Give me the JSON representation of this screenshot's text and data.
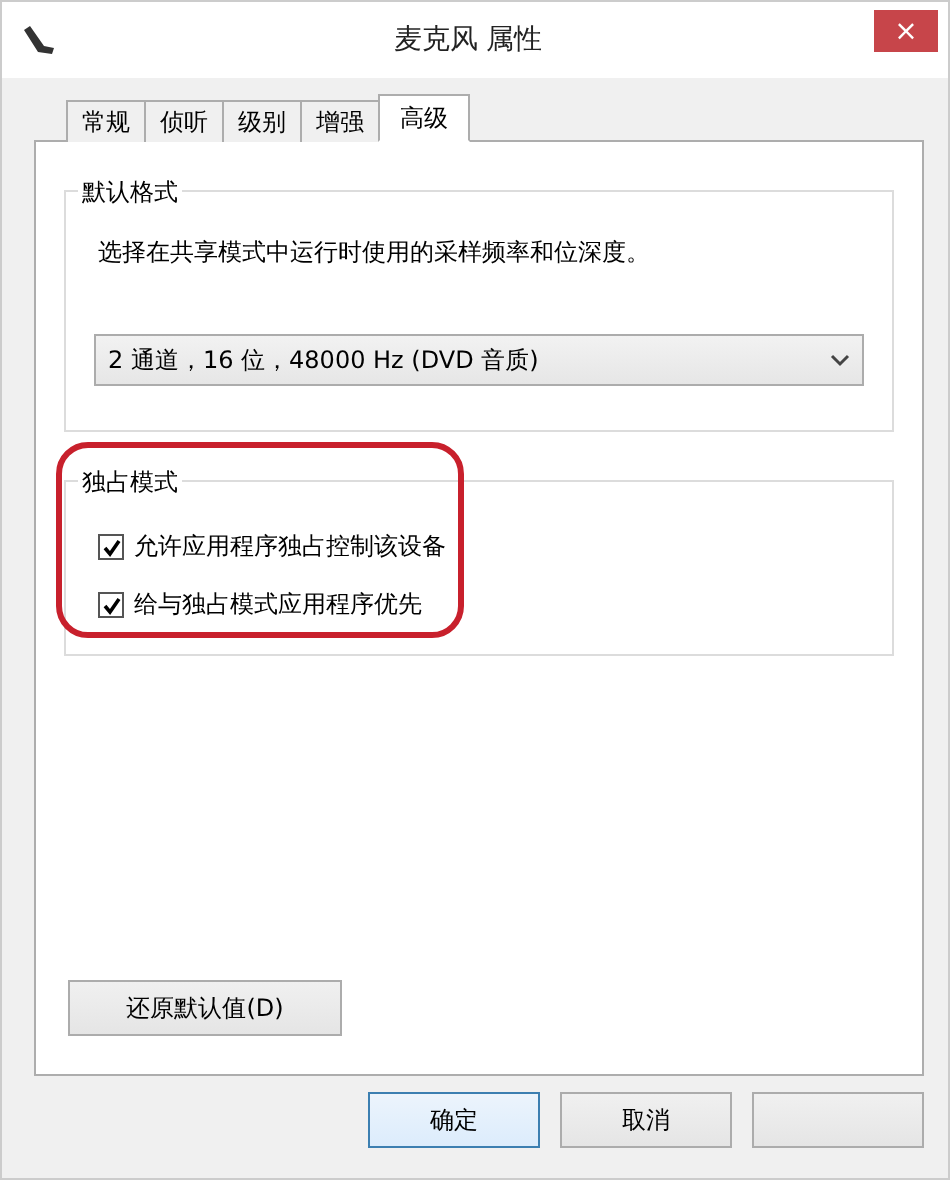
{
  "window": {
    "title": "麦克风 属性",
    "close": "×"
  },
  "tabs": [
    {
      "label": "常规",
      "selected": false
    },
    {
      "label": "侦听",
      "selected": false
    },
    {
      "label": "级别",
      "selected": false
    },
    {
      "label": "增强",
      "selected": false
    },
    {
      "label": "高级",
      "selected": true
    }
  ],
  "default_format": {
    "title": "默认格式",
    "description": "选择在共享模式中运行时使用的采样频率和位深度。",
    "dropdown": {
      "value": "2 通道，16 位，48000 Hz (DVD 音质)"
    }
  },
  "exclusive_mode": {
    "title": "独占模式",
    "options": [
      {
        "label": "允许应用程序独占控制该设备",
        "checked": true
      },
      {
        "label": "给与独占模式应用程序优先",
        "checked": true
      }
    ],
    "annotation": {
      "kind": "outline",
      "color": "#c8202c"
    }
  },
  "restore_button": "还原默认值(D)",
  "buttons": [
    {
      "kind": "labeled",
      "label": "确定",
      "default": true
    },
    {
      "kind": "labeled",
      "label": "取消",
      "default": false
    },
    {
      "kind": "blank"
    }
  ]
}
